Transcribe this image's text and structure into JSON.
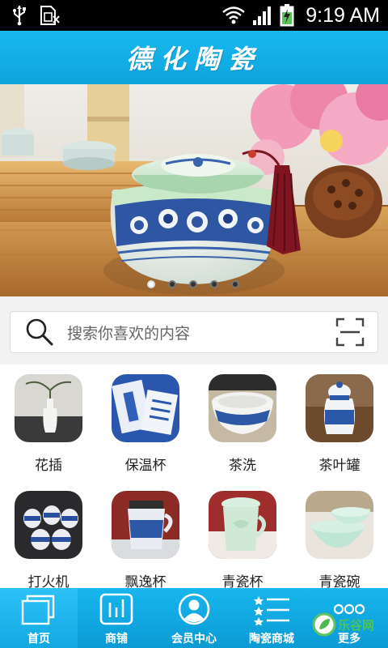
{
  "status_bar": {
    "time": "9:19 AM",
    "icons": [
      "usb-icon",
      "sim-icon",
      "wifi-icon",
      "signal-icon",
      "battery-icon"
    ]
  },
  "header": {
    "title": "德化陶瓷"
  },
  "banner": {
    "slide_count": 5,
    "active_slide": 1
  },
  "search": {
    "placeholder": "搜索你喜欢的内容"
  },
  "categories": [
    {
      "label": "花插"
    },
    {
      "label": "保温杯"
    },
    {
      "label": "茶洗"
    },
    {
      "label": "茶叶罐"
    },
    {
      "label": "打火机"
    },
    {
      "label": "飘逸杯"
    },
    {
      "label": "青瓷杯"
    },
    {
      "label": "青瓷碗"
    }
  ],
  "tabbar": {
    "items": [
      {
        "label": "首页",
        "icon": "home-icon",
        "active": true
      },
      {
        "label": "商铺",
        "icon": "shop-icon",
        "active": false
      },
      {
        "label": "会员中心",
        "icon": "member-icon",
        "active": false
      },
      {
        "label": "陶瓷商城",
        "icon": "list-icon",
        "active": false
      },
      {
        "label": "更多",
        "icon": "more-icon",
        "active": false
      }
    ]
  },
  "watermark": {
    "text": "乐谷网"
  },
  "colors": {
    "accent": "#12aae6",
    "status_bar": "#000000",
    "background": "#f2f2f2"
  }
}
